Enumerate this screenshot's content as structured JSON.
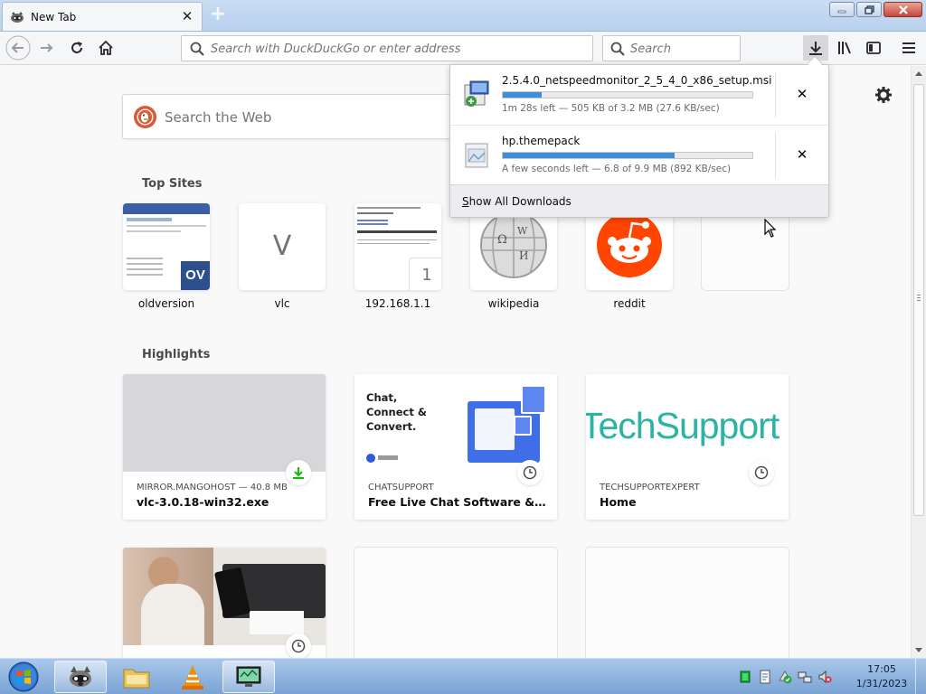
{
  "browser": {
    "tab": {
      "title": "New Tab",
      "close": "✕"
    },
    "new_tab": "+",
    "url_placeholder": "Search with DuckDuckGo or enter address",
    "search_placeholder": "Search"
  },
  "page": {
    "web_search_placeholder": "Search the Web",
    "top_sites_heading": "Top Sites",
    "highlights_heading": "Highlights",
    "top_sites": [
      {
        "label": "oldversion"
      },
      {
        "label": "vlc",
        "letter": "V"
      },
      {
        "label": "192.168.1.1",
        "badge": "1"
      },
      {
        "label": "wikipedia"
      },
      {
        "label": "reddit"
      }
    ],
    "highlights": [
      {
        "meta": "MIRROR.MANGOHOST — 40.8 MB",
        "title": "vlc-3.0.18-win32.exe"
      },
      {
        "meta": "CHATSUPPORT",
        "title": "Free Live Chat Software & Webs...",
        "img_text": "Chat,\nConnect &\nConvert."
      },
      {
        "meta": "TECHSUPPORTEXPERT",
        "title": "Home",
        "img_text": "TechSupport"
      }
    ]
  },
  "downloads": {
    "items": [
      {
        "name": "2.5.4.0_netspeedmonitor_2_5_4_0_x86_setup.msi",
        "status": "1m 28s left — 505 KB of 3.2 MB (27.6 KB/sec)",
        "progress": 0.155
      },
      {
        "name": "hp.themepack",
        "status": "A few seconds left — 6.8 of 9.9 MB (892 KB/sec)",
        "progress": 0.687
      }
    ],
    "show_all": "Show All Downloads",
    "cancel": "✕"
  },
  "taskbar": {
    "time": "17:05",
    "date": "1/31/2023"
  },
  "colors": {
    "accent": "#0a84ff",
    "progress": "#3f8ed9",
    "reddit": "#ff4500",
    "duckduckgo": "#de5833",
    "download_green": "#12bc00"
  }
}
